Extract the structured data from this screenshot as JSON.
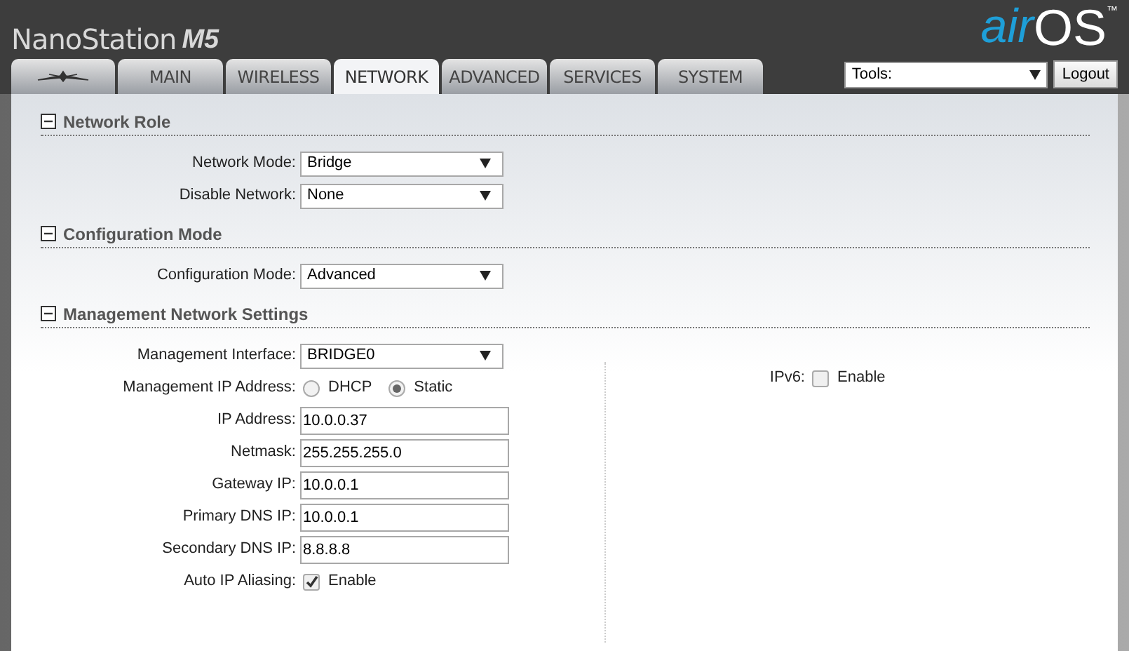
{
  "header": {
    "product_name": "NanoStation",
    "model": "M5",
    "logo": {
      "prefix": "air",
      "suffix": "OS",
      "trademark": "™"
    }
  },
  "tabs": [
    {
      "kind": "icon",
      "selected": false
    },
    {
      "kind": "text",
      "label": "MAIN",
      "selected": false
    },
    {
      "kind": "text",
      "label": "WIRELESS",
      "selected": false
    },
    {
      "kind": "text",
      "label": "NETWORK",
      "selected": true
    },
    {
      "kind": "text",
      "label": "ADVANCED",
      "selected": false
    },
    {
      "kind": "text",
      "label": "SERVICES",
      "selected": false
    },
    {
      "kind": "text",
      "label": "SYSTEM",
      "selected": false
    }
  ],
  "tools": {
    "value": "Tools:"
  },
  "logout_button": "Logout",
  "sections": [
    {
      "title": "Network Role",
      "expanded": true,
      "left": [
        {
          "kind": "select",
          "label": "Network Mode:",
          "value": "Bridge"
        },
        {
          "kind": "select",
          "label": "Disable Network:",
          "value": "None"
        }
      ]
    },
    {
      "title": "Configuration Mode",
      "expanded": true,
      "left": [
        {
          "kind": "select",
          "label": "Configuration Mode:",
          "value": "Advanced"
        }
      ]
    },
    {
      "title": "Management Network Settings",
      "expanded": true,
      "left": [
        {
          "kind": "select",
          "label": "Management Interface:",
          "value": "BRIDGE0"
        },
        {
          "kind": "radio",
          "label": "Management IP Address:",
          "options": [
            {
              "label": "DHCP",
              "selected": false
            },
            {
              "label": "Static",
              "selected": true
            }
          ]
        },
        {
          "kind": "text",
          "label": "IP Address:",
          "value": "10.0.0.37"
        },
        {
          "kind": "text",
          "label": "Netmask:",
          "value": "255.255.255.0"
        },
        {
          "kind": "text",
          "label": "Gateway IP:",
          "value": "10.0.0.1"
        },
        {
          "kind": "text",
          "label": "Primary DNS IP:",
          "value": "10.0.0.1"
        },
        {
          "kind": "text",
          "label": "Secondary DNS IP:",
          "value": "8.8.8.8"
        },
        {
          "kind": "checkbox",
          "label": "Auto IP Aliasing:",
          "option": "Enable",
          "checked": true
        }
      ],
      "right": [
        {
          "kind": "checkbox",
          "label": "IPv6:",
          "option": "Enable",
          "checked": false
        }
      ]
    }
  ]
}
